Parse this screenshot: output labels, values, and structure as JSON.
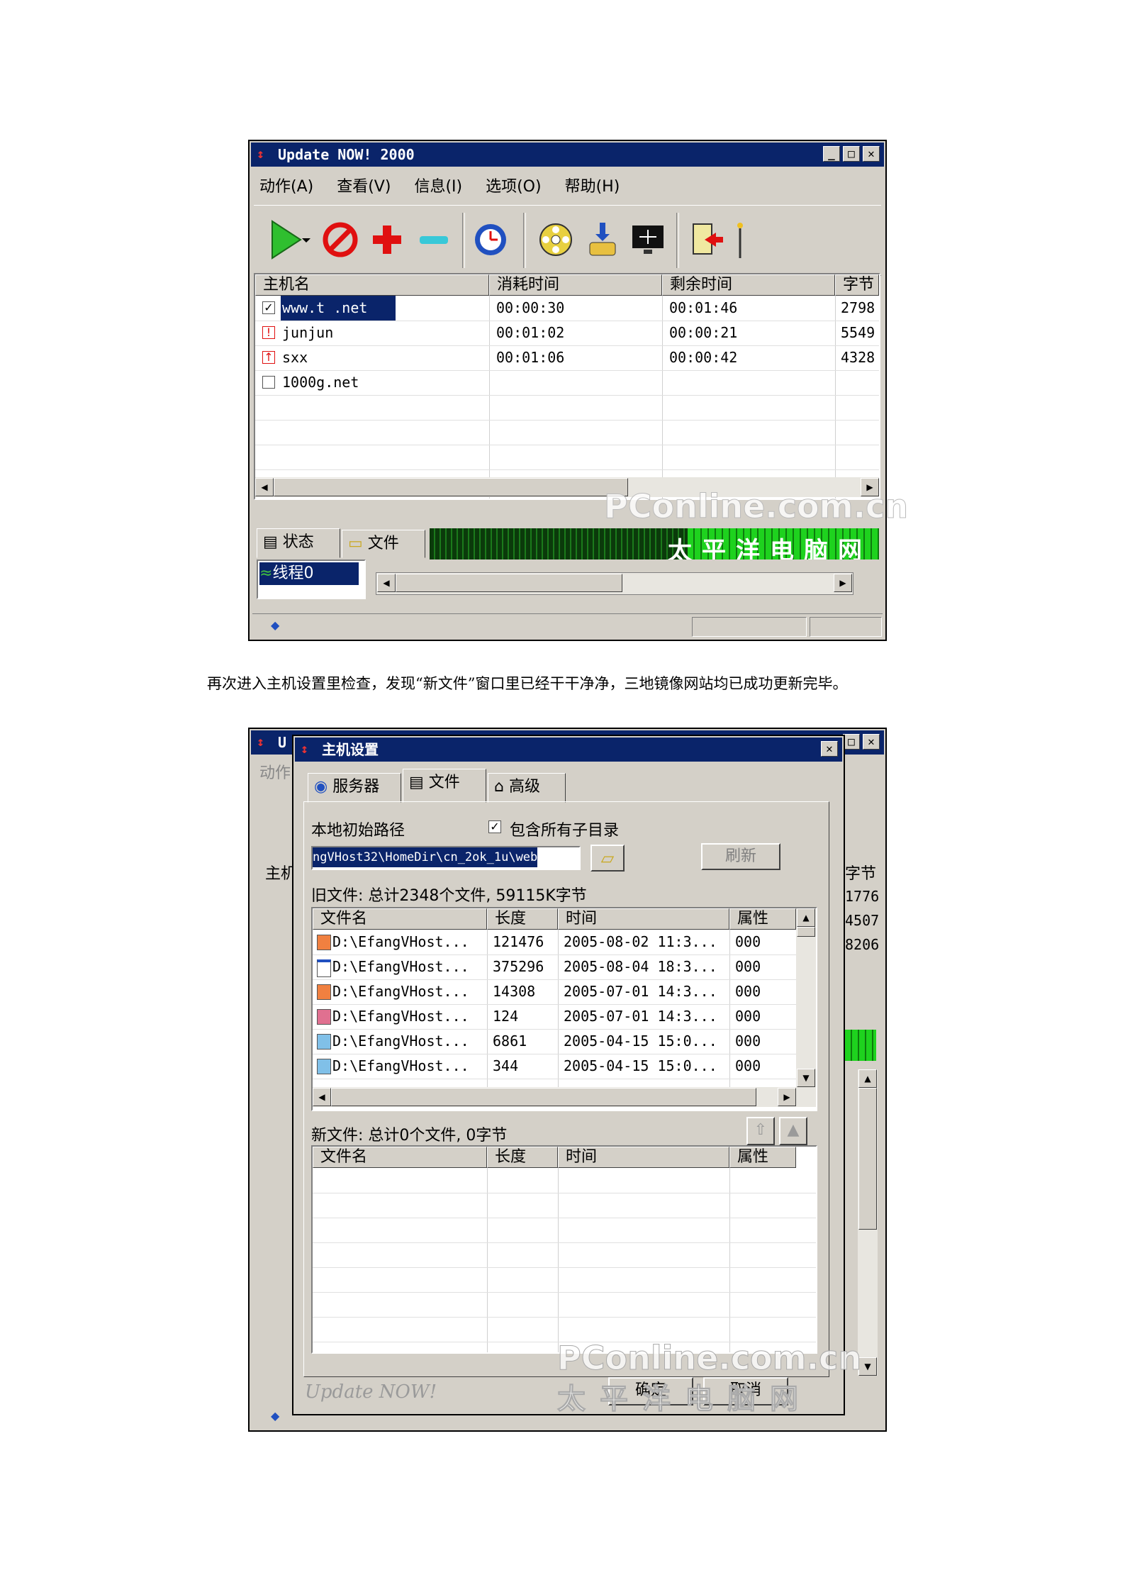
{
  "main_window": {
    "title": "Update NOW! 2000",
    "menu": [
      "动作(A)",
      "查看(V)",
      "信息(I)",
      "选项(O)",
      "帮助(H)"
    ],
    "columns": [
      "主机名",
      "消耗时间",
      "剩余时间",
      "字节"
    ],
    "rows": [
      {
        "host": "www.t  .net",
        "elapsed": "00:00:30",
        "remaining": "00:01:46",
        "bytes": "2798",
        "checked": true
      },
      {
        "host": "junjun",
        "elapsed": "00:01:02",
        "remaining": "00:00:21",
        "bytes": "5549",
        "checked": false
      },
      {
        "host": "sxx",
        "elapsed": "00:01:06",
        "remaining": "00:00:42",
        "bytes": "4328",
        "checked": false
      },
      {
        "host": "1000g.net",
        "elapsed": "",
        "remaining": "",
        "bytes": "",
        "checked": false
      }
    ],
    "tabs": [
      "状态",
      "文件"
    ],
    "thread_label": "线程0",
    "banner_text": "PConline.com.cn",
    "banner_cn": "太平洋电脑网"
  },
  "caption": "再次进入主机设置里检查，发现“新文件”窗口里已经干干净净，三地镜像网站均已成功更新完毕。",
  "dialog": {
    "title": "主机设置",
    "bg_title_partial": "U",
    "bg_menu_partial": "动作",
    "bg_header_partial": [
      "主机",
      "字节"
    ],
    "bg_bytes": [
      "1776",
      "4507",
      "8206"
    ],
    "tabs": [
      "服务器",
      "文件",
      "高级"
    ],
    "local_path_label": "本地初始路径",
    "include_subdirs_label": "包含所有子目录",
    "path_value": "ngVHost32\\HomeDir\\cn_2ok_1u\\web",
    "refresh_button": "刷新",
    "old_files_label": "旧文件: 总计2348个文件, 59115K字节",
    "columns": [
      "文件名",
      "长度",
      "时间",
      "属性"
    ],
    "old_files": [
      {
        "name": "D:\\EfangVHost...",
        "size": "121476",
        "time": "2005-08-02 11:3...",
        "attr": "000"
      },
      {
        "name": "D:\\EfangVHost...",
        "size": "375296",
        "time": "2005-08-04 18:3...",
        "attr": "000"
      },
      {
        "name": "D:\\EfangVHost...",
        "size": "14308",
        "time": "2005-07-01 14:3...",
        "attr": "000"
      },
      {
        "name": "D:\\EfangVHost...",
        "size": "124",
        "time": "2005-07-01 14:3...",
        "attr": "000"
      },
      {
        "name": "D:\\EfangVHost...",
        "size": "6861",
        "time": "2005-04-15 15:0...",
        "attr": "000"
      },
      {
        "name": "D:\\EfangVHost...",
        "size": "344",
        "time": "2005-04-15 15:0...",
        "attr": "000"
      }
    ],
    "new_files_label": "新文件: 总计0个文件, 0字节",
    "footer_brand": "Update NOW!",
    "ok_button": "确定",
    "cancel_button": "取消",
    "watermark": "PConline.com.cn",
    "watermark_cn": "太平洋电脑网"
  },
  "colors": {
    "titlebar": "#0a246a",
    "chrome": "#d4d0c8",
    "accent_green": "#2fbf2f"
  }
}
